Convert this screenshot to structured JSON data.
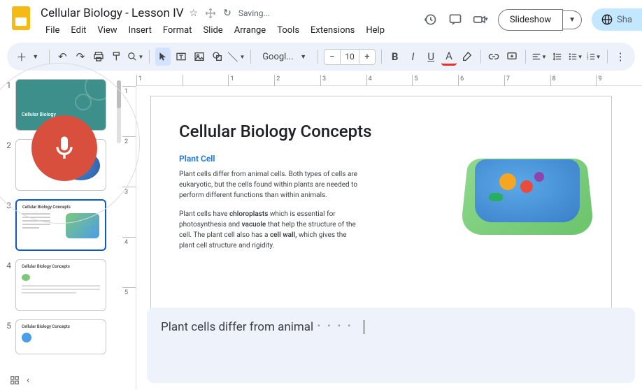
{
  "doc_title": "Cellular Biology - Lesson IV",
  "saving_label": "Saving...",
  "menu": {
    "file": "File",
    "edit": "Edit",
    "view": "View",
    "insert": "Insert",
    "format": "Format",
    "slide": "Slide",
    "arrange": "Arrange",
    "tools": "Tools",
    "extensions": "Extensions",
    "help": "Help"
  },
  "header_buttons": {
    "slideshow": "Slideshow",
    "share": "Sha"
  },
  "toolbar": {
    "font_name": "Googl...",
    "font_size": "10"
  },
  "ruler_h": [
    "1",
    "",
    "1",
    "2",
    "3",
    "4",
    "5",
    "6",
    "7",
    "8",
    "9"
  ],
  "ruler_v": [
    "1",
    "2",
    "3",
    "4",
    "5"
  ],
  "slides": [
    {
      "num": "1",
      "title": "Cellular Biology"
    },
    {
      "num": "2",
      "title": ""
    },
    {
      "num": "3",
      "title": "Cellular Biology Concepts"
    },
    {
      "num": "4",
      "title": "Cellular Biology Concepts"
    },
    {
      "num": "5",
      "title": "Cellular Biology Concepts"
    }
  ],
  "canvas": {
    "title": "Cellular Biology Concepts",
    "subtitle": "Plant Cell",
    "p1": "Plant cells differ from animal cells. Both types of cells are eukaryotic, but the cells found within plants are needed to perform different functions than within animals.",
    "p2_a": "Plant cells have ",
    "p2_b": "chloroplasts",
    "p2_c": " which is essential for photosynthesis and ",
    "p2_d": "vacuole",
    "p2_e": " that help the structure of the cell. The plant cell also has a ",
    "p2_f": "cell wall,",
    "p2_g": " which gives the plant cell structure and rigidity."
  },
  "voice_input": "Plant cells differ from animal"
}
